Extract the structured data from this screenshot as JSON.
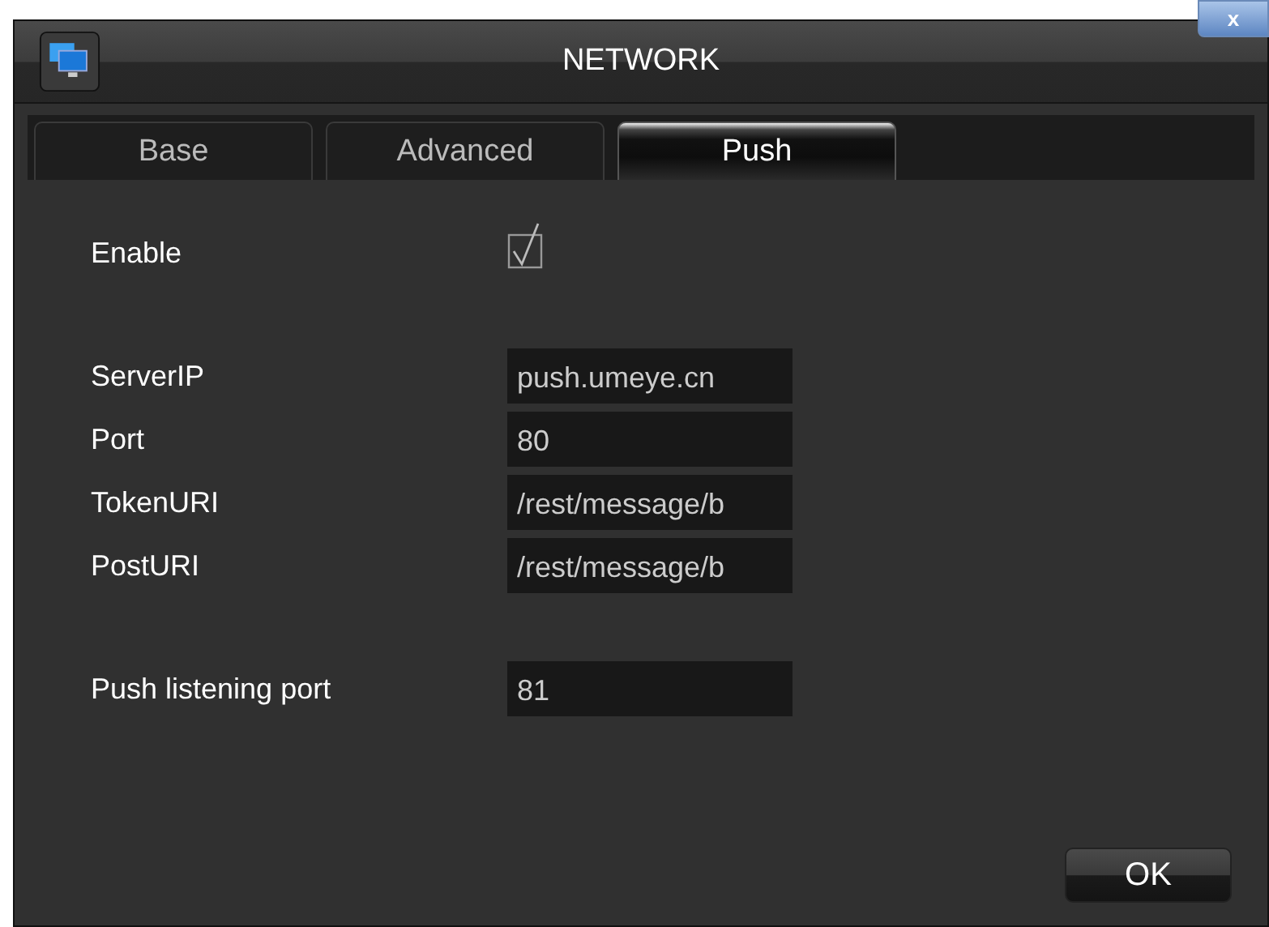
{
  "window": {
    "title": "NETWORK",
    "close_label": "x"
  },
  "tabs": [
    {
      "label": "Base",
      "selected": false
    },
    {
      "label": "Advanced",
      "selected": false
    },
    {
      "label": "Push",
      "selected": true
    }
  ],
  "groups": [
    [
      {
        "kind": "checkbox",
        "label": "Enable",
        "checked": true
      }
    ],
    [
      {
        "kind": "field",
        "label": "ServerIP",
        "value": "push.umeye.cn"
      },
      {
        "kind": "field",
        "label": "Port",
        "value": "80"
      },
      {
        "kind": "field",
        "label": "TokenURI",
        "value": "/rest/message/b"
      },
      {
        "kind": "field",
        "label": "PostURI",
        "value": "/rest/message/b"
      }
    ],
    [
      {
        "kind": "field",
        "label": "Push listening port",
        "value": "81"
      }
    ]
  ],
  "buttons": [
    "OK"
  ]
}
